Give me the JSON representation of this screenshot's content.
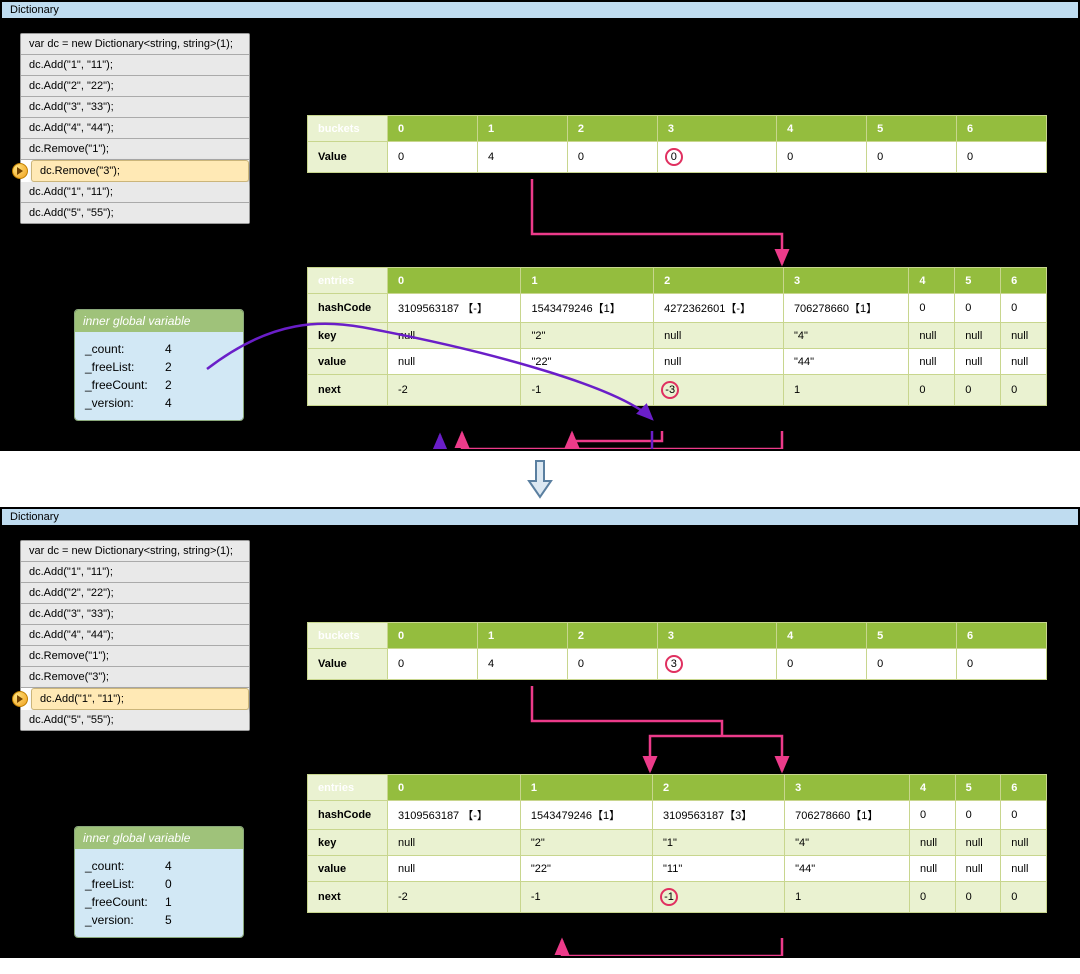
{
  "panelTitle": "Dictionary",
  "codeLines": [
    "var dc = new Dictionary<string, string>(1);",
    "dc.Add(\"1\", \"11\");",
    "dc.Add(\"2\", \"22\");",
    "dc.Add(\"3\", \"33\");",
    " dc.Add(\"4\", \"44\");",
    "dc.Remove(\"1\");",
    "dc.Remove(\"3\");",
    "dc.Add(\"1\", \"11\");",
    "dc.Add(\"5\", \"55\");"
  ],
  "innerHeader": "inner global variable",
  "top": {
    "highlightIndex": 6,
    "inner": {
      "_count": "4",
      "_freeList": "2",
      "_freeCount": "2",
      "_version": "4"
    },
    "buckets": {
      "title": "buckets",
      "cols": [
        "0",
        "1",
        "2",
        "3",
        "4",
        "5",
        "6"
      ],
      "valueLabel": "Value",
      "values": [
        "0",
        "4",
        "0",
        "0",
        "0",
        "0",
        "0"
      ],
      "circleCol": 3
    },
    "entries": {
      "title": "entries",
      "cols": [
        "0",
        "1",
        "2",
        "3",
        "4",
        "5",
        "6"
      ],
      "rows": [
        {
          "label": "hashCode",
          "vals": [
            "3109563187 【-】",
            "1543479246【1】",
            "4272362601【-】",
            "706278660【1】",
            "0",
            "0",
            "0"
          ]
        },
        {
          "label": "key",
          "vals": [
            "null",
            "\"2\"",
            "null",
            "\"4\"",
            "null",
            "null",
            "null"
          ]
        },
        {
          "label": "value",
          "vals": [
            "null",
            "\"22\"",
            "null",
            "\"44\"",
            "null",
            "null",
            "null"
          ]
        },
        {
          "label": "next",
          "vals": [
            "-2",
            "-1",
            "-3",
            "1",
            "0",
            "0",
            "0"
          ]
        }
      ],
      "circleRow": 3,
      "circleCol": 2
    }
  },
  "bottom": {
    "highlightIndex": 7,
    "inner": {
      "_count": "4",
      "_freeList": "0",
      "_freeCount": "1",
      "_version": "5"
    },
    "buckets": {
      "title": "buckets",
      "cols": [
        "0",
        "1",
        "2",
        "3",
        "4",
        "5",
        "6"
      ],
      "valueLabel": "Value",
      "values": [
        "0",
        "4",
        "0",
        "3",
        "0",
        "0",
        "0"
      ],
      "circleCol": 3
    },
    "entries": {
      "title": "entries",
      "cols": [
        "0",
        "1",
        "2",
        "3",
        "4",
        "5",
        "6"
      ],
      "rows": [
        {
          "label": "hashCode",
          "vals": [
            "3109563187 【-】",
            "1543479246【1】",
            "3109563187【3】",
            "706278660【1】",
            "0",
            "0",
            "0"
          ]
        },
        {
          "label": "key",
          "vals": [
            "null",
            "\"2\"",
            "\"1\"",
            "\"4\"",
            "null",
            "null",
            "null"
          ]
        },
        {
          "label": "value",
          "vals": [
            "null",
            "\"22\"",
            "\"11\"",
            "\"44\"",
            "null",
            "null",
            "null"
          ]
        },
        {
          "label": "next",
          "vals": [
            "-2",
            "-1",
            "-1",
            "1",
            "0",
            "0",
            "0"
          ]
        }
      ],
      "circleRow": 3,
      "circleCol": 2
    }
  }
}
